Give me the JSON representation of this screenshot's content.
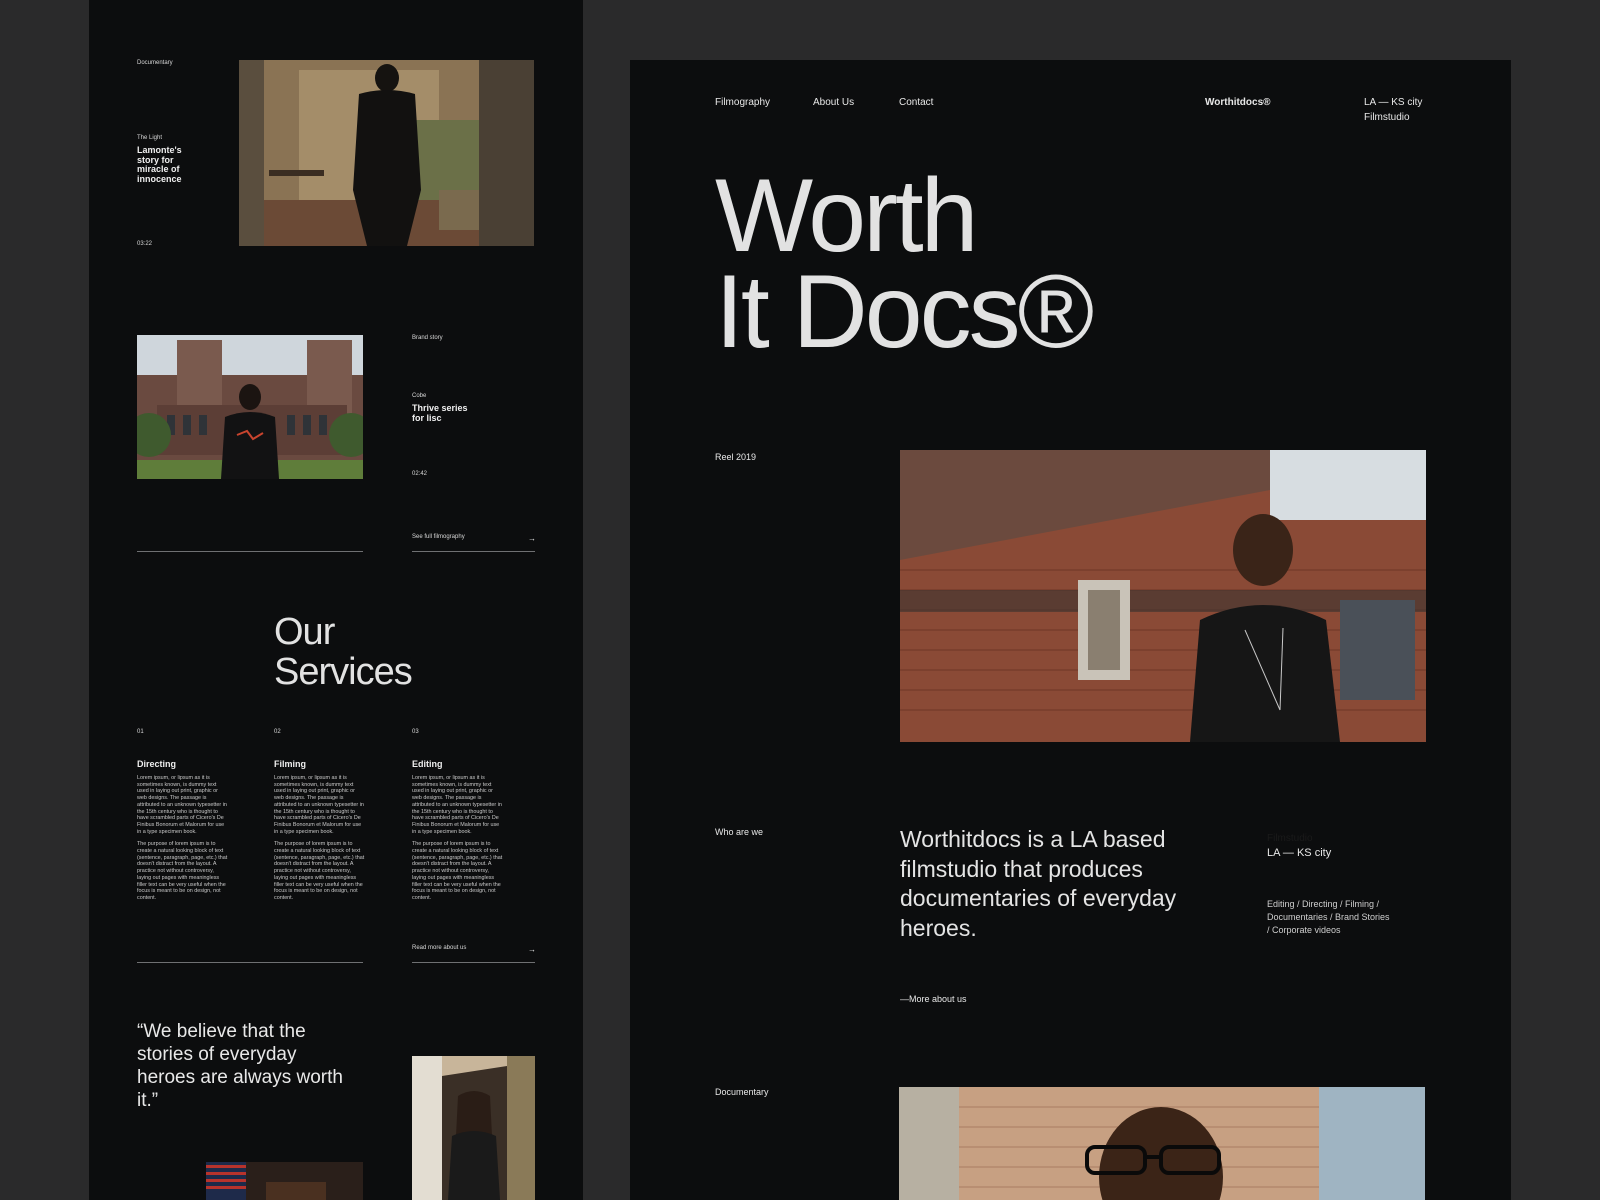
{
  "left": {
    "film1": {
      "category": "Documentary",
      "subtitle": "The Light",
      "title": "Lamonte's story for miracle of innocence",
      "duration": "03:22"
    },
    "film2": {
      "category": "Brand story",
      "subtitle": "Cobe",
      "title": "Thrive series for lisc",
      "duration": "02:42"
    },
    "see_full_link": "See full filmography",
    "services_title": "Our Services",
    "services": [
      {
        "num": "01",
        "title": "Directing",
        "p1": "Lorem ipsum, or lipsum as it is sometimes known, is dummy text used in laying out print, graphic or web designs. The passage is attributed to an unknown typesetter in the 15th century who is thought to have scrambled parts of Cicero's De Finibus Bonorum et Malorum for use in a type specimen book.",
        "p2": "The purpose of lorem ipsum is to create a natural looking block of text (sentence, paragraph, page, etc.) that doesn't distract from the layout. A practice not without controversy, laying out pages with meaningless filler text can be very useful when the focus is meant to be on design, not content."
      },
      {
        "num": "02",
        "title": "Filming",
        "p1": "Lorem ipsum, or lipsum as it is sometimes known, is dummy text used in laying out print, graphic or web designs. The passage is attributed to an unknown typesetter in the 15th century who is thought to have scrambled parts of Cicero's De Finibus Bonorum et Malorum for use in a type specimen book.",
        "p2": "The purpose of lorem ipsum is to create a natural looking block of text (sentence, paragraph, page, etc.) that doesn't distract from the layout. A practice not without controversy, laying out pages with meaningless filler text can be very useful when the focus is meant to be on design, not content."
      },
      {
        "num": "03",
        "title": "Editing",
        "p1": "Lorem ipsum, or lipsum as it is sometimes known, is dummy text used in laying out print, graphic or web designs. The passage is attributed to an unknown typesetter in the 15th century who is thought to have scrambled parts of Cicero's De Finibus Bonorum et Malorum for use in a type specimen book.",
        "p2": "The purpose of lorem ipsum is to create a natural looking block of text (sentence, paragraph, page, etc.) that doesn't distract from the layout. A practice not without controversy, laying out pages with meaningless filler text can be very useful when the focus is meant to be on design, not content."
      }
    ],
    "read_more_link": "Read more about us",
    "quote": "“We believe that the stories of everyday heroes are always worth it.”",
    "arrow_glyph": "→"
  },
  "right": {
    "nav": {
      "filmography": "Filmography",
      "about": "About Us",
      "contact": "Contact",
      "brand": "Worthitdocs®",
      "location_line1": "LA — KS city",
      "location_line2": "Filmstudio"
    },
    "hero_line1": "Worth",
    "hero_line2": "It Docs®",
    "reel_label": "Reel 2019",
    "who_label": "Who are we",
    "about_text": "Worthitdocs is a LA based filmstudio that produces documentaries of everyday heroes.",
    "studio_label": "Filmstudio",
    "studio_location": "LA — KS city",
    "services_list": "Editing / Directing / Filming / Documentaries / Brand Stories / Corporate videos",
    "more_about_link": "—More about us",
    "documentary_label": "Documentary"
  },
  "colors": {
    "page_bg": "#2a2a2b",
    "panel_bg": "#0c0d0e",
    "text": "#e4e4e4",
    "rule": "#6f7072"
  }
}
